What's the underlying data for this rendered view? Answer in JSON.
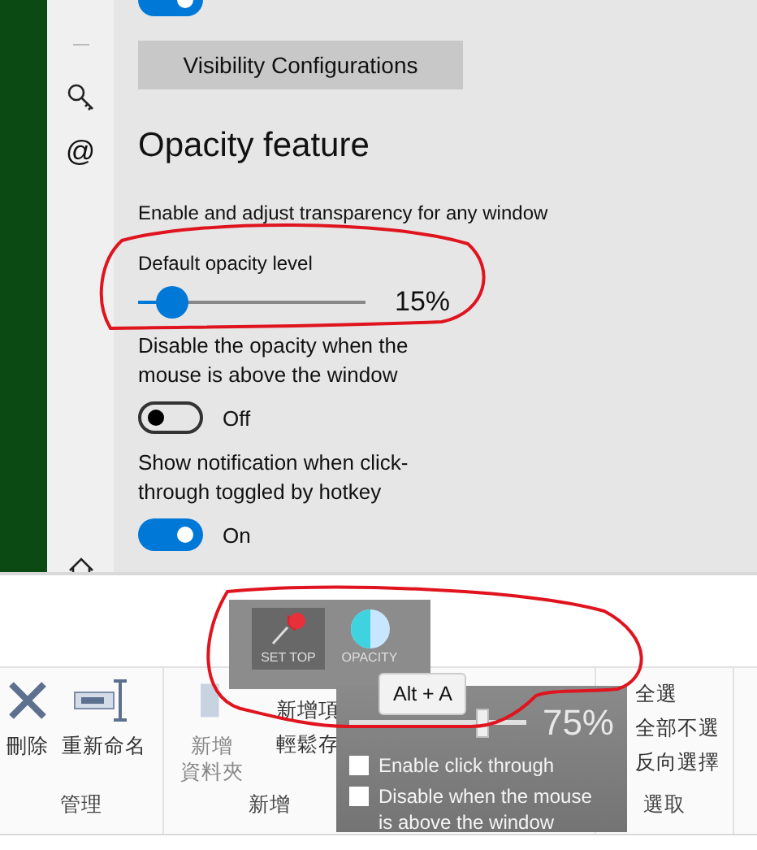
{
  "settings": {
    "sidebar": {
      "at_icon": "@"
    },
    "top_toggle": {
      "on": true
    },
    "visibility_button": "Visibility Configurations",
    "heading": "Opacity feature",
    "description": "Enable and adjust transparency for any window",
    "slider": {
      "label": "Default opacity level",
      "level": 0.15,
      "reading": "15%"
    },
    "toggles": [
      {
        "label": "Disable the opacity when the mouse is above the window",
        "on": false,
        "state_text": "Off"
      },
      {
        "label": "Show notification when click-through toggled by hotkey",
        "on": true,
        "state_text": "On"
      }
    ]
  },
  "ribbon": {
    "groups": [
      {
        "label": "管理",
        "commands": [
          {
            "kind": "delete",
            "lines": [
              "刪除"
            ]
          },
          {
            "kind": "rename",
            "lines": [
              "重新命名"
            ]
          }
        ]
      },
      {
        "label": "新增",
        "commands": [
          {
            "kind": "folder",
            "lines": [
              "新增",
              "資料夾"
            ]
          },
          {
            "kind": "small-list",
            "lines": [
              "新增項",
              "輕鬆存"
            ]
          }
        ]
      },
      {
        "label": "選取",
        "commands": [
          {
            "kind": "small-list",
            "lines": [
              "全選",
              "全部不選",
              "反向選擇"
            ]
          }
        ]
      }
    ]
  },
  "popup": {
    "toolbar": [
      {
        "kind": "pin",
        "label": "SET TOP",
        "selected": true
      },
      {
        "kind": "opacity",
        "label": "OPACITY",
        "selected": false
      }
    ],
    "tooltip": "Alt + A",
    "level": 0.75,
    "reading": "75%",
    "checkboxes": [
      {
        "label": "Enable click through",
        "checked": false
      },
      {
        "label": "Disable when the mouse is above the window",
        "checked": false
      }
    ]
  }
}
